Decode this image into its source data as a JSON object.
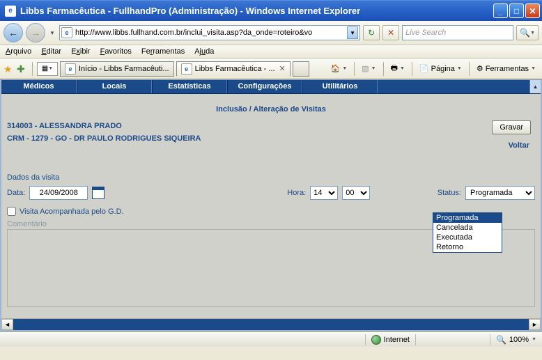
{
  "window": {
    "title": "Libbs Farmacêutica - FullhandPro (Administração) - Windows Internet Explorer"
  },
  "address": {
    "url": "http://www.libbs.fullhand.com.br/inclui_visita.asp?da_onde=roteiro&vo"
  },
  "search": {
    "placeholder": "Live Search"
  },
  "menubar": {
    "arquivo": "Arquivo",
    "editar": "Editar",
    "exibir": "Exibir",
    "favoritos": "Favoritos",
    "ferramentas": "Ferramentas",
    "ajuda": "Ajuda"
  },
  "browser_tabs": {
    "tab1": "Início - Libbs Farmacêuti...",
    "tab2": "Libbs Farmacêutica - ..."
  },
  "cmdbar": {
    "pagina": "Página",
    "ferramentas": "Ferramentas"
  },
  "app_tabs": {
    "medicos": "Médicos",
    "locais": "Locais",
    "estatisticas": "Estatísticas",
    "configuracoes": "Configurações",
    "utilitarios": "Utilitários"
  },
  "page": {
    "title": "Inclusão / Alteração de Visitas",
    "rep": "314003 - ALESSANDRA PRADO",
    "doctor": "CRM - 1279 - GO - DR PAULO RODRIGUES SIQUEIRA",
    "gravar": "Gravar",
    "voltar": "Voltar",
    "section": "Dados da visita",
    "data_label": "Data:",
    "data_value": "24/09/2008",
    "hora_label": "Hora:",
    "hora_h": "14",
    "hora_m": "00",
    "status_label": "Status:",
    "status_value": "Programada",
    "status_options": {
      "o1": "Programada",
      "o2": "Cancelada",
      "o3": "Executada",
      "o4": "Retorno"
    },
    "chk_label": "Visita Acompanhada pelo G.D.",
    "comment_label": "Comentário"
  },
  "statusbar": {
    "zone": "Internet",
    "zoom": "100%"
  }
}
